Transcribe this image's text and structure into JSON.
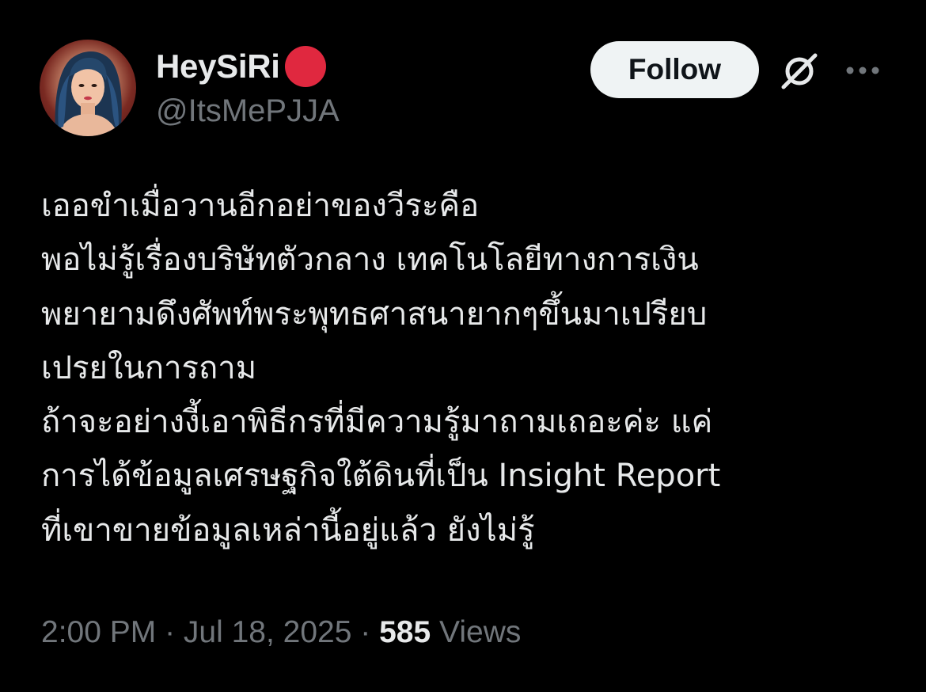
{
  "author": {
    "display_name": "HeySiRi",
    "handle": "@ItsMePJJA",
    "badge_color": "#e0283f"
  },
  "actions": {
    "follow_label": "Follow",
    "grok_icon": "grok-slash-circle-icon",
    "more_icon": "more-horizontal-icon"
  },
  "tweet": {
    "lines": [
      "เออขำเมื่อวานอีกอย่าของวีระคือ",
      "พอไม่รู้เรื่องบริษัทตัวกลาง เทคโนโลยีทางการเงิน",
      "พยายามดึงศัพท์พระพุทธศาสนายากๆขึ้นมาเปรียบ",
      "เปรยในการถาม",
      "ถ้าจะอย่างงี้เอาพิธีกรที่มีความรู้มาถามเถอะค่ะ แค่",
      "การได้ข้อมูลเศรษฐกิจใต้ดินที่เป็น Insight Report",
      "ที่เขาขายข้อมูลเหล่านี้อยู่แล้ว ยังไม่รู้"
    ]
  },
  "meta": {
    "time": "2:00 PM",
    "separator": " · ",
    "date": "Jul 18, 2025",
    "views_count": "585",
    "views_label": "Views"
  }
}
